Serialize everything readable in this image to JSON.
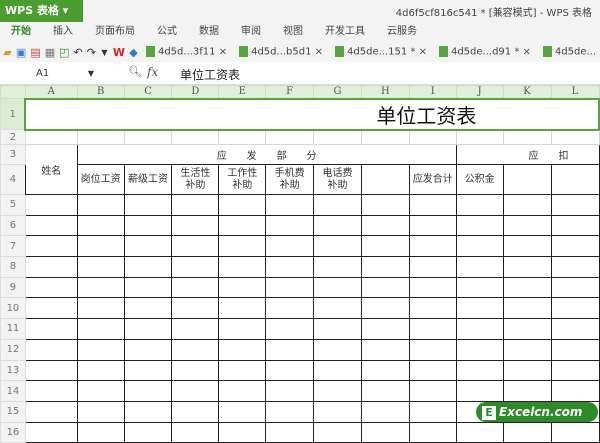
{
  "app": {
    "button": "WPS 表格 ▾",
    "title": "4d6f5cf816c541 * [兼容模式] - WPS 表格"
  },
  "menu": [
    "开始",
    "插入",
    "页面布局",
    "公式",
    "数据",
    "审阅",
    "视图",
    "开发工具",
    "云服务"
  ],
  "doc_tabs": [
    "4d5d...3f11 ×",
    "4d5d...b5d1 ×",
    "4d5de...151 * ×",
    "4d5de...d91 * ×",
    "4d5de..."
  ],
  "formula": {
    "cell": "A1",
    "fx": "fx",
    "value": "单位工资表"
  },
  "columns": [
    "A",
    "B",
    "C",
    "D",
    "E",
    "F",
    "G",
    "H",
    "I",
    "J",
    "K",
    "L"
  ],
  "rows": [
    "1",
    "2",
    "3",
    "4",
    "5",
    "6",
    "7",
    "8",
    "9",
    "10",
    "11",
    "12",
    "13",
    "14",
    "15",
    "16"
  ],
  "sheet": {
    "title": "单位工资表",
    "name": "姓名",
    "group1": "应　　发　　部　　分",
    "group2": "应　　扣",
    "headers": [
      "岗位工资",
      "薪级工资",
      "生活性\n补助",
      "工作性\n补助",
      "手机费\n补助",
      "电话费\n补助",
      "",
      "应发合计",
      "公积金",
      "",
      ""
    ]
  },
  "watermark": "Excelcn.com"
}
